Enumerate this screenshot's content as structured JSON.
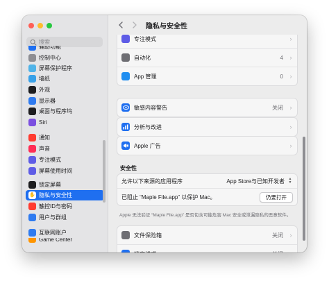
{
  "sidebar": {
    "search_placeholder": "搜索",
    "items": [
      {
        "label": "辅助功能",
        "icon": "accessibility-icon",
        "color": "#1f6ff0",
        "partial": true
      },
      {
        "label": "控制中心",
        "icon": "control-center-icon",
        "color": "#8e8e93"
      },
      {
        "label": "屏幕保护程序",
        "icon": "screen-saver-icon",
        "color": "#4fb3e8"
      },
      {
        "label": "墙纸",
        "icon": "wallpaper-icon",
        "color": "#38a1e8"
      },
      {
        "label": "外观",
        "icon": "appearance-icon",
        "color": "#1d1d1f"
      },
      {
        "label": "显示器",
        "icon": "display-icon",
        "color": "#2f7bf0"
      },
      {
        "label": "桌面与程序坞",
        "icon": "dock-icon",
        "color": "#1d1d1f"
      },
      {
        "label": "Siri",
        "icon": "siri-icon",
        "color": "#7b4fe0"
      },
      {
        "label": "通知",
        "icon": "notifications-icon",
        "color": "#ff3b30"
      },
      {
        "label": "声音",
        "icon": "sound-icon",
        "color": "#ff2d55"
      },
      {
        "label": "专注模式",
        "icon": "focus-icon",
        "color": "#5e5ce6"
      },
      {
        "label": "屏幕使用时间",
        "icon": "screen-time-icon",
        "color": "#5e5ce6"
      },
      {
        "label": "锁定屏幕",
        "icon": "lock-screen-icon",
        "color": "#1d1d1f"
      },
      {
        "label": "隐私与安全性",
        "icon": "hand-icon",
        "color": "#1f6ff0",
        "active": true
      },
      {
        "label": "触控ID与密码",
        "icon": "touch-id-icon",
        "color": "#ff3b30"
      },
      {
        "label": "用户与群组",
        "icon": "users-icon",
        "color": "#2f7bf0"
      },
      {
        "label": "互联网账户",
        "icon": "internet-accounts-icon",
        "color": "#2f7bf0"
      },
      {
        "label": "Game Center",
        "icon": "game-center-icon",
        "color": "#ff9500",
        "partial": true
      }
    ]
  },
  "header": {
    "title": "隐私与安全性"
  },
  "main": {
    "group1": [
      {
        "label": "专注模式",
        "icon": "focus-icon",
        "color": "#5e5ce6",
        "value": "",
        "partial": true
      },
      {
        "label": "自动化",
        "icon": "automation-icon",
        "color": "#6e6e73",
        "value": "4"
      },
      {
        "label": "App 管理",
        "icon": "app-store-icon",
        "color": "#1f8ef0",
        "value": "0"
      }
    ],
    "sensitive": {
      "label": "敏感内容警告",
      "icon": "eye-icon",
      "color": "#1f6ff0",
      "value": "关闭"
    },
    "analytics": {
      "label": "分析与改进",
      "icon": "analytics-icon",
      "color": "#1f6ff0"
    },
    "ads": {
      "label": "Apple 广告",
      "icon": "megaphone-icon",
      "color": "#1f6ff0"
    },
    "security": {
      "title": "安全性",
      "allow_label": "允许以下来源的应用程序",
      "allow_value": "App Store与已知开发者",
      "blocked_label": "已阻止 “Maple File.app” 以保护 Mac。",
      "open_button": "仍要打开",
      "note": "Apple 无法验证 “Maple File.app” 是否包含可能危害 Mac 安全或泄漏隐私的恶意软件。"
    },
    "group_bottom": [
      {
        "label": "文件保险箱",
        "icon": "filevault-icon",
        "color": "#6e6e73",
        "value": "关闭"
      },
      {
        "label": "锁定模式",
        "icon": "lockdown-hand-icon",
        "color": "#1f6ff0",
        "value": "关闭"
      }
    ]
  }
}
